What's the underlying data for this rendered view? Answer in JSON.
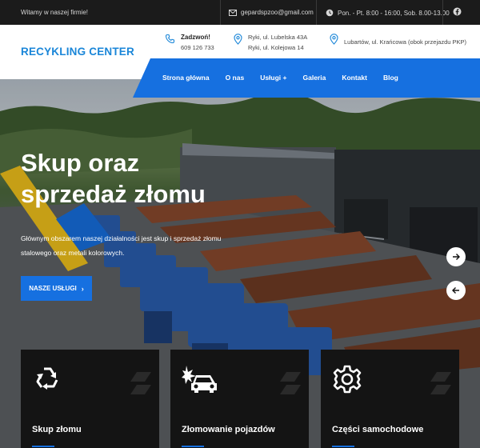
{
  "topbar": {
    "welcome": "Witamy w naszej firmie!",
    "email": "gepardspzoo@gmail.com",
    "hours": "Pon. - Pt. 8:00 - 16:00, Sob. 8.00-13.00"
  },
  "header": {
    "logo": "RECYKLING CENTER",
    "call_label": "Zadzwoń!",
    "phone": "609 126 733",
    "address1_line1": "Ryki, ul. Lubelska 43A",
    "address1_line2": "Ryki, ul. Kolejowa 14",
    "address2": "Lubartów, ul. Krańcowa (obok przejazdu PKP)"
  },
  "nav": {
    "items": [
      "Strona główna",
      "O nas",
      "Usługi +",
      "Galeria",
      "Kontakt",
      "Blog"
    ]
  },
  "hero": {
    "title_line1": "Skup oraz",
    "title_line2": "sprzedaż złomu",
    "subtitle": "Głównym obszarem naszej działalności jest skup i sprzedaż złomu stalowego oraz metali kolorowych.",
    "button": "NASZE USŁUGI"
  },
  "cards": [
    {
      "title": "Skup złomu",
      "icon": "recycle-icon"
    },
    {
      "title": "Złomowanie pojazdów",
      "icon": "car-crash-icon"
    },
    {
      "title": "Części samochodowe",
      "icon": "gear-icon"
    }
  ],
  "colors": {
    "accent": "#1670e0",
    "logo": "#1a86d8",
    "topbar": "#1b1b1b",
    "card": "#141414"
  }
}
